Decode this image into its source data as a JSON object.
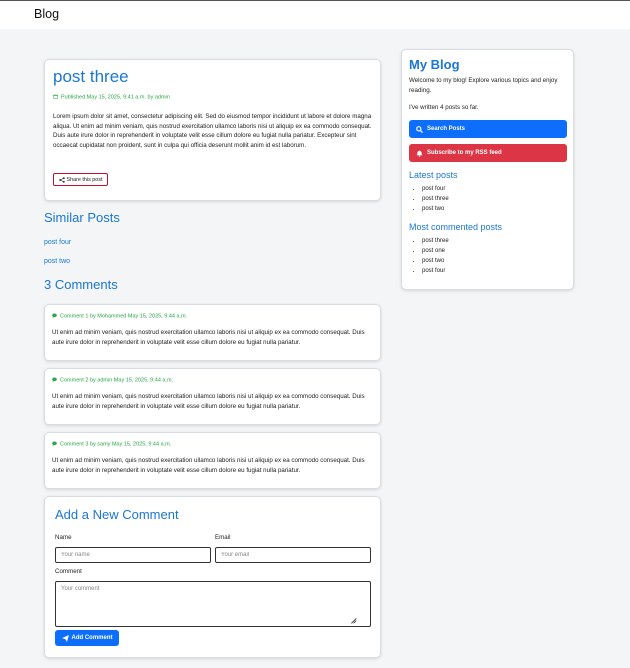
{
  "nav": {
    "brand": "Blog"
  },
  "post": {
    "title": "post three",
    "meta": "Published May 15, 2025, 9:41 a.m. by admin",
    "body": "Lorem ipsum dolor sit amet, consectetur adipiscing elit. Sed do eiusmod tempor incididunt ut labore et dolore magna aliqua. Ut enim ad minim veniam, quis nostrud exercitation ullamco laboris nisi ut aliquip ex ea commodo consequat. Duis aute irure dolor in reprehenderit in voluptate velit esse cillum dolore eu fugiat nulla pariatur. Excepteur sint occaecat cupidatat non proident, sunt in culpa qui officia deserunt mollit anim id est laborum.",
    "share_label": "Share this post"
  },
  "similar": {
    "title": "Similar Posts",
    "links": [
      "post four",
      "post two"
    ]
  },
  "comments": {
    "title": "3 Comments",
    "items": [
      {
        "meta": "Comment 1 by Mohammed   May 15, 2025, 9:44 a.m.",
        "text": "Ut enim ad minim veniam, quis nostrud exercitation ullamco laboris nisi ut aliquip ex ea commodo consequat. Duis aute irure dolor in reprehenderit in voluptate velit esse cillum dolore eu fugiat nulla pariatur."
      },
      {
        "meta": "Comment 2 by admin   May 15, 2025, 9:44 a.m.",
        "text": "Ut enim ad minim veniam, quis nostrud exercitation ullamco laboris nisi ut aliquip ex ea commodo consequat. Duis aute irure dolor in reprehenderit in voluptate velit esse cillum dolore eu fugiat nulla pariatur."
      },
      {
        "meta": "Comment 3 by samy   May 15, 2025, 9:44 a.m.",
        "text": "Ut enim ad minim veniam, quis nostrud exercitation ullamco laboris nisi ut aliquip ex ea commodo consequat. Duis aute irure dolor in reprehenderit in voluptate velit esse cillum dolore eu fugiat nulla pariatur."
      }
    ]
  },
  "form": {
    "title": "Add a New Comment",
    "name_label": "Name",
    "name_placeholder": "Your name",
    "email_label": "Email",
    "email_placeholder": "Your email",
    "comment_label": "Comment",
    "comment_placeholder": "Your comment",
    "submit_label": "Add Comment"
  },
  "sidebar": {
    "title": "My Blog",
    "intro": "Welcome to my blog! Explore various topics and enjoy reading.",
    "count_text": "I've written 4 posts so far.",
    "search_label": "Search Posts",
    "rss_label": "Subscribe to my RSS feed",
    "latest_title": "Latest posts",
    "latest": [
      "post four",
      "post three",
      "post two"
    ],
    "commented_title": "Most commented posts",
    "commented": [
      "post three",
      "post one",
      "post two",
      "post four"
    ]
  },
  "colors": {
    "accent": "#1a77d2",
    "primary_button": "#0d6efd",
    "danger_button": "#dc3545",
    "meta_green": "#28a745",
    "share_border": "#c0122c"
  },
  "icons": {
    "calendar": "calendar-icon",
    "share": "share-icon",
    "comment": "comment-icon",
    "search": "search-icon",
    "bell": "bell-icon",
    "send": "paper-plane-icon"
  }
}
